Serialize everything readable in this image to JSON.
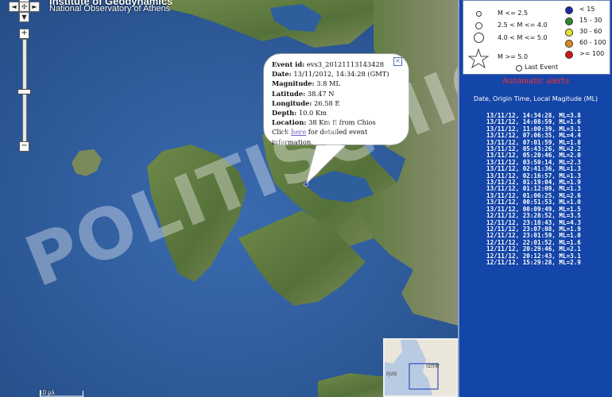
{
  "header": {
    "title": "Institute of Geodynamics",
    "subtitle": "National Observatory of Athens"
  },
  "popup": {
    "event_label": "Event id:",
    "event_value": "evs3_20121113143428",
    "date_label": "Date:",
    "date_value": "13/11/2012, 14:34:28 (GMT)",
    "mag_label": "Magnitude:",
    "mag_value": "3.8 ML",
    "lat_label": "Latitude:",
    "lat_value": "38.47 N",
    "lon_label": "Longitude:",
    "lon_value": "26.58 E",
    "depth_label": "Depth:",
    "depth_value": "10.0 Km",
    "loc_label": "Location:",
    "loc_value": "38 Km E from Chios",
    "click_prefix": "Click",
    "link_text": "here",
    "click_suffix": "for detailed event information.",
    "close_icon": "close-icon"
  },
  "legend": {
    "mag_items": [
      "M <= 2.5",
      "2.5 < M <= 4.0",
      "4.0 < M <= 5.0",
      "M >= 5.0"
    ],
    "last_event": "Last Event",
    "depth_items": [
      {
        "label": "< 15",
        "color": "#1a2aa8"
      },
      {
        "label": "15 - 30",
        "color": "#2a8a2a"
      },
      {
        "label": "30 - 60",
        "color": "#e8e030"
      },
      {
        "label": "60 - 100",
        "color": "#e08a20"
      },
      {
        "label": ">= 100",
        "color": "#d01818"
      }
    ]
  },
  "alerts": {
    "title": "Automatic alerts",
    "subtitle": "Date, Origin Time, Local Magitude (ML)",
    "items": [
      "13/11/12, 14:34:28, ML=3.8",
      "13/11/12, 14:08:59, ML=1.6",
      "13/11/12, 11:00:39, ML=3.1",
      "13/11/12, 07:06:35, ML=4.4",
      "13/11/12, 07:01:59, ML=1.8",
      "13/11/12, 05:43:26, ML=2.2",
      "13/11/12, 05:20:46, ML=2.0",
      "13/11/12, 03:50:14, ML=2.3",
      "13/11/12, 02:41:36, ML=1.3",
      "13/11/12, 02:16:57, ML=1.3",
      "13/11/12, 01:19:04, ML=1.9",
      "13/11/12, 01:12:09, ML=1.3",
      "13/11/12, 01:06:25, ML=2.6",
      "13/11/12, 00:51:53, ML=1.0",
      "13/11/12, 00:09:49, ML=1.5",
      "12/11/12, 23:28:52, ML=3.5",
      "12/11/12, 23:18:43, ML=4.3",
      "12/11/12, 23:07:08, ML=1.9",
      "12/11/12, 23:01:59, ML=1.0",
      "12/11/12, 22:01:52, ML=1.6",
      "12/11/12, 20:29:46, ML=2.1",
      "12/11/12, 20:12:43, ML=3.1",
      "12/11/12, 15:29:28, ML=2.9"
    ]
  },
  "map": {
    "scale_label": "10 μλ",
    "overview_label_left": "ηνα",
    "overview_label_right": "Izmir",
    "watermark": "POLITISCHIOS.GR",
    "colors": {
      "sea": "#2f5e9c",
      "land": "#5f7a40",
      "alert_title": "#ff3030",
      "sidebar": "#1445a8"
    }
  }
}
